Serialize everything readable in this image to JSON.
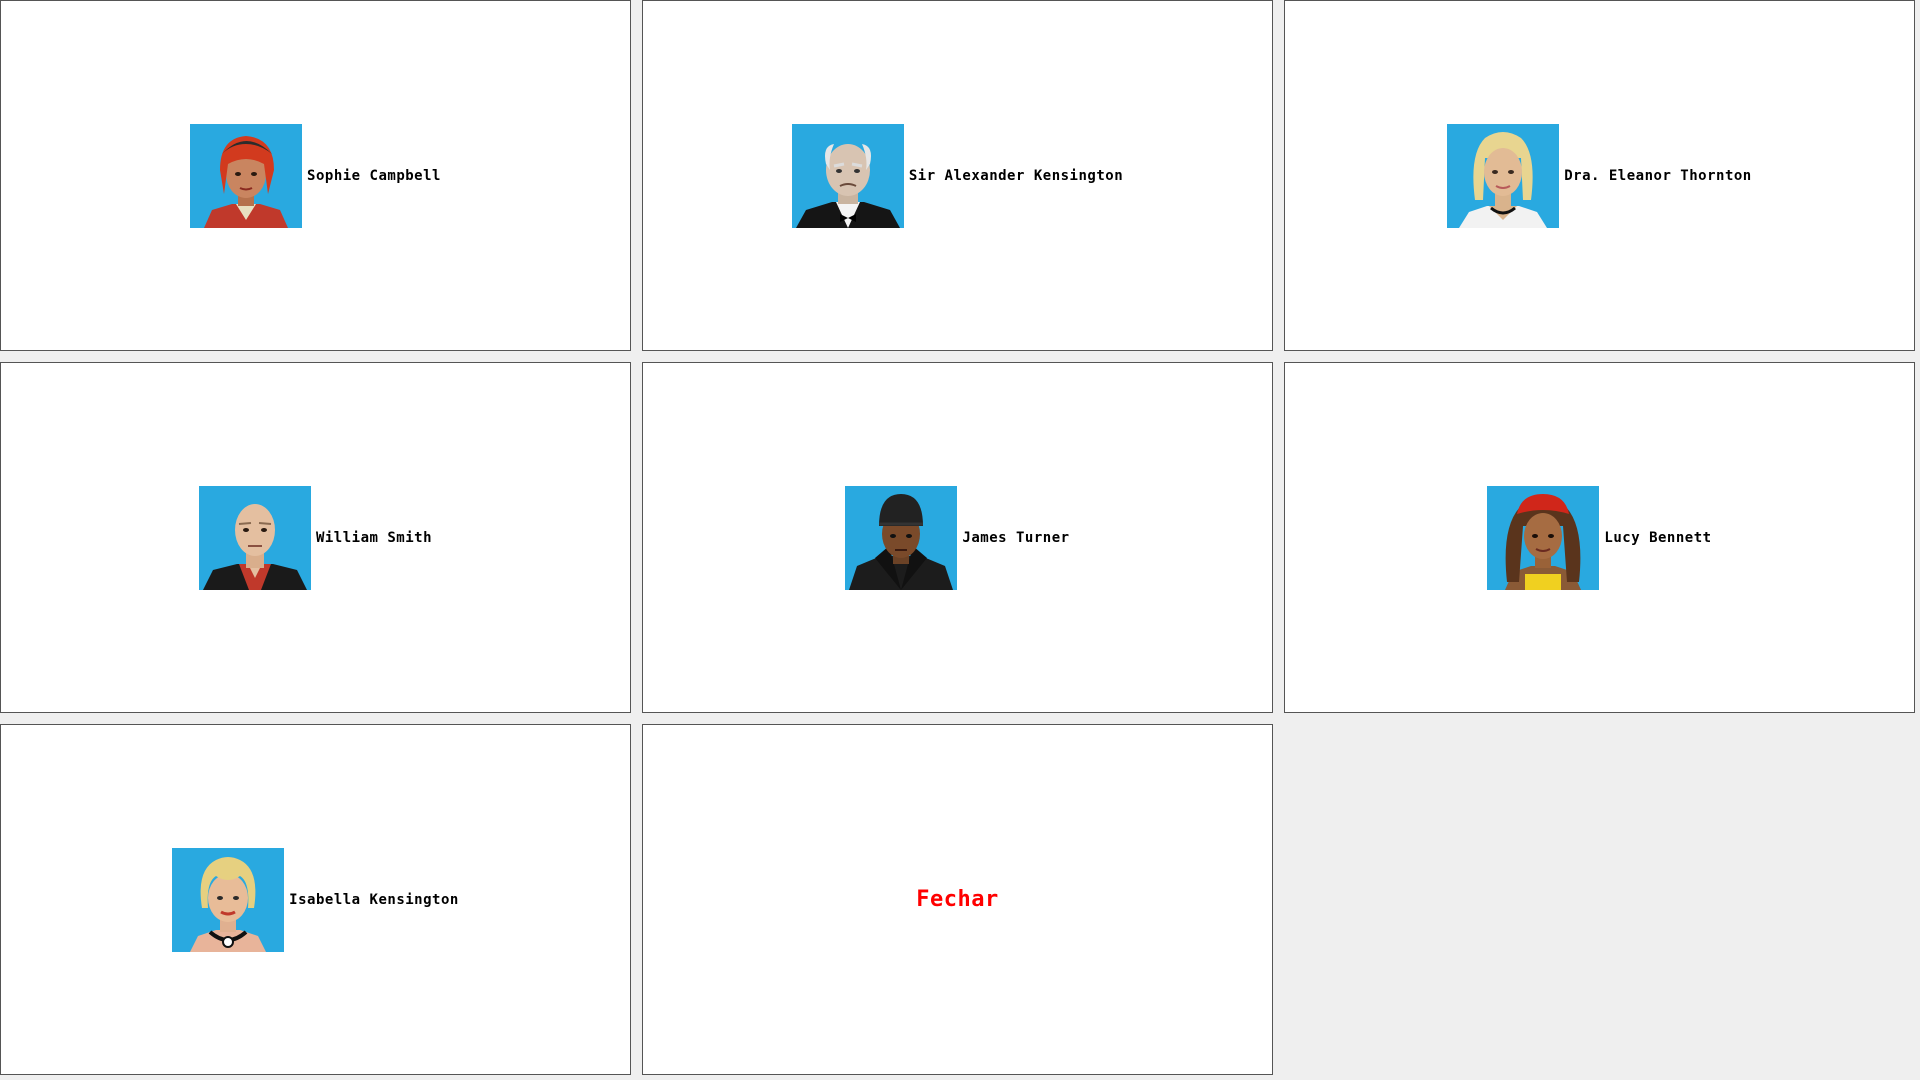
{
  "characters": [
    {
      "name": "Sophie Campbell",
      "icon": "sophie-portrait-icon"
    },
    {
      "name": "Sir Alexander Kensington",
      "icon": "alexander-portrait-icon"
    },
    {
      "name": "Dra. Eleanor Thornton",
      "icon": "eleanor-portrait-icon"
    },
    {
      "name": "William Smith",
      "icon": "william-portrait-icon"
    },
    {
      "name": "James Turner",
      "icon": "james-portrait-icon"
    },
    {
      "name": "Lucy Bennett",
      "icon": "lucy-portrait-icon"
    },
    {
      "name": "Isabella Kensington",
      "icon": "isabella-portrait-icon"
    }
  ],
  "close": {
    "label": "Fechar"
  },
  "colors": {
    "portrait_bg": "#29a9e0",
    "close_text": "#ff0000",
    "card_bg": "#ffffff",
    "page_bg": "#efefef"
  }
}
